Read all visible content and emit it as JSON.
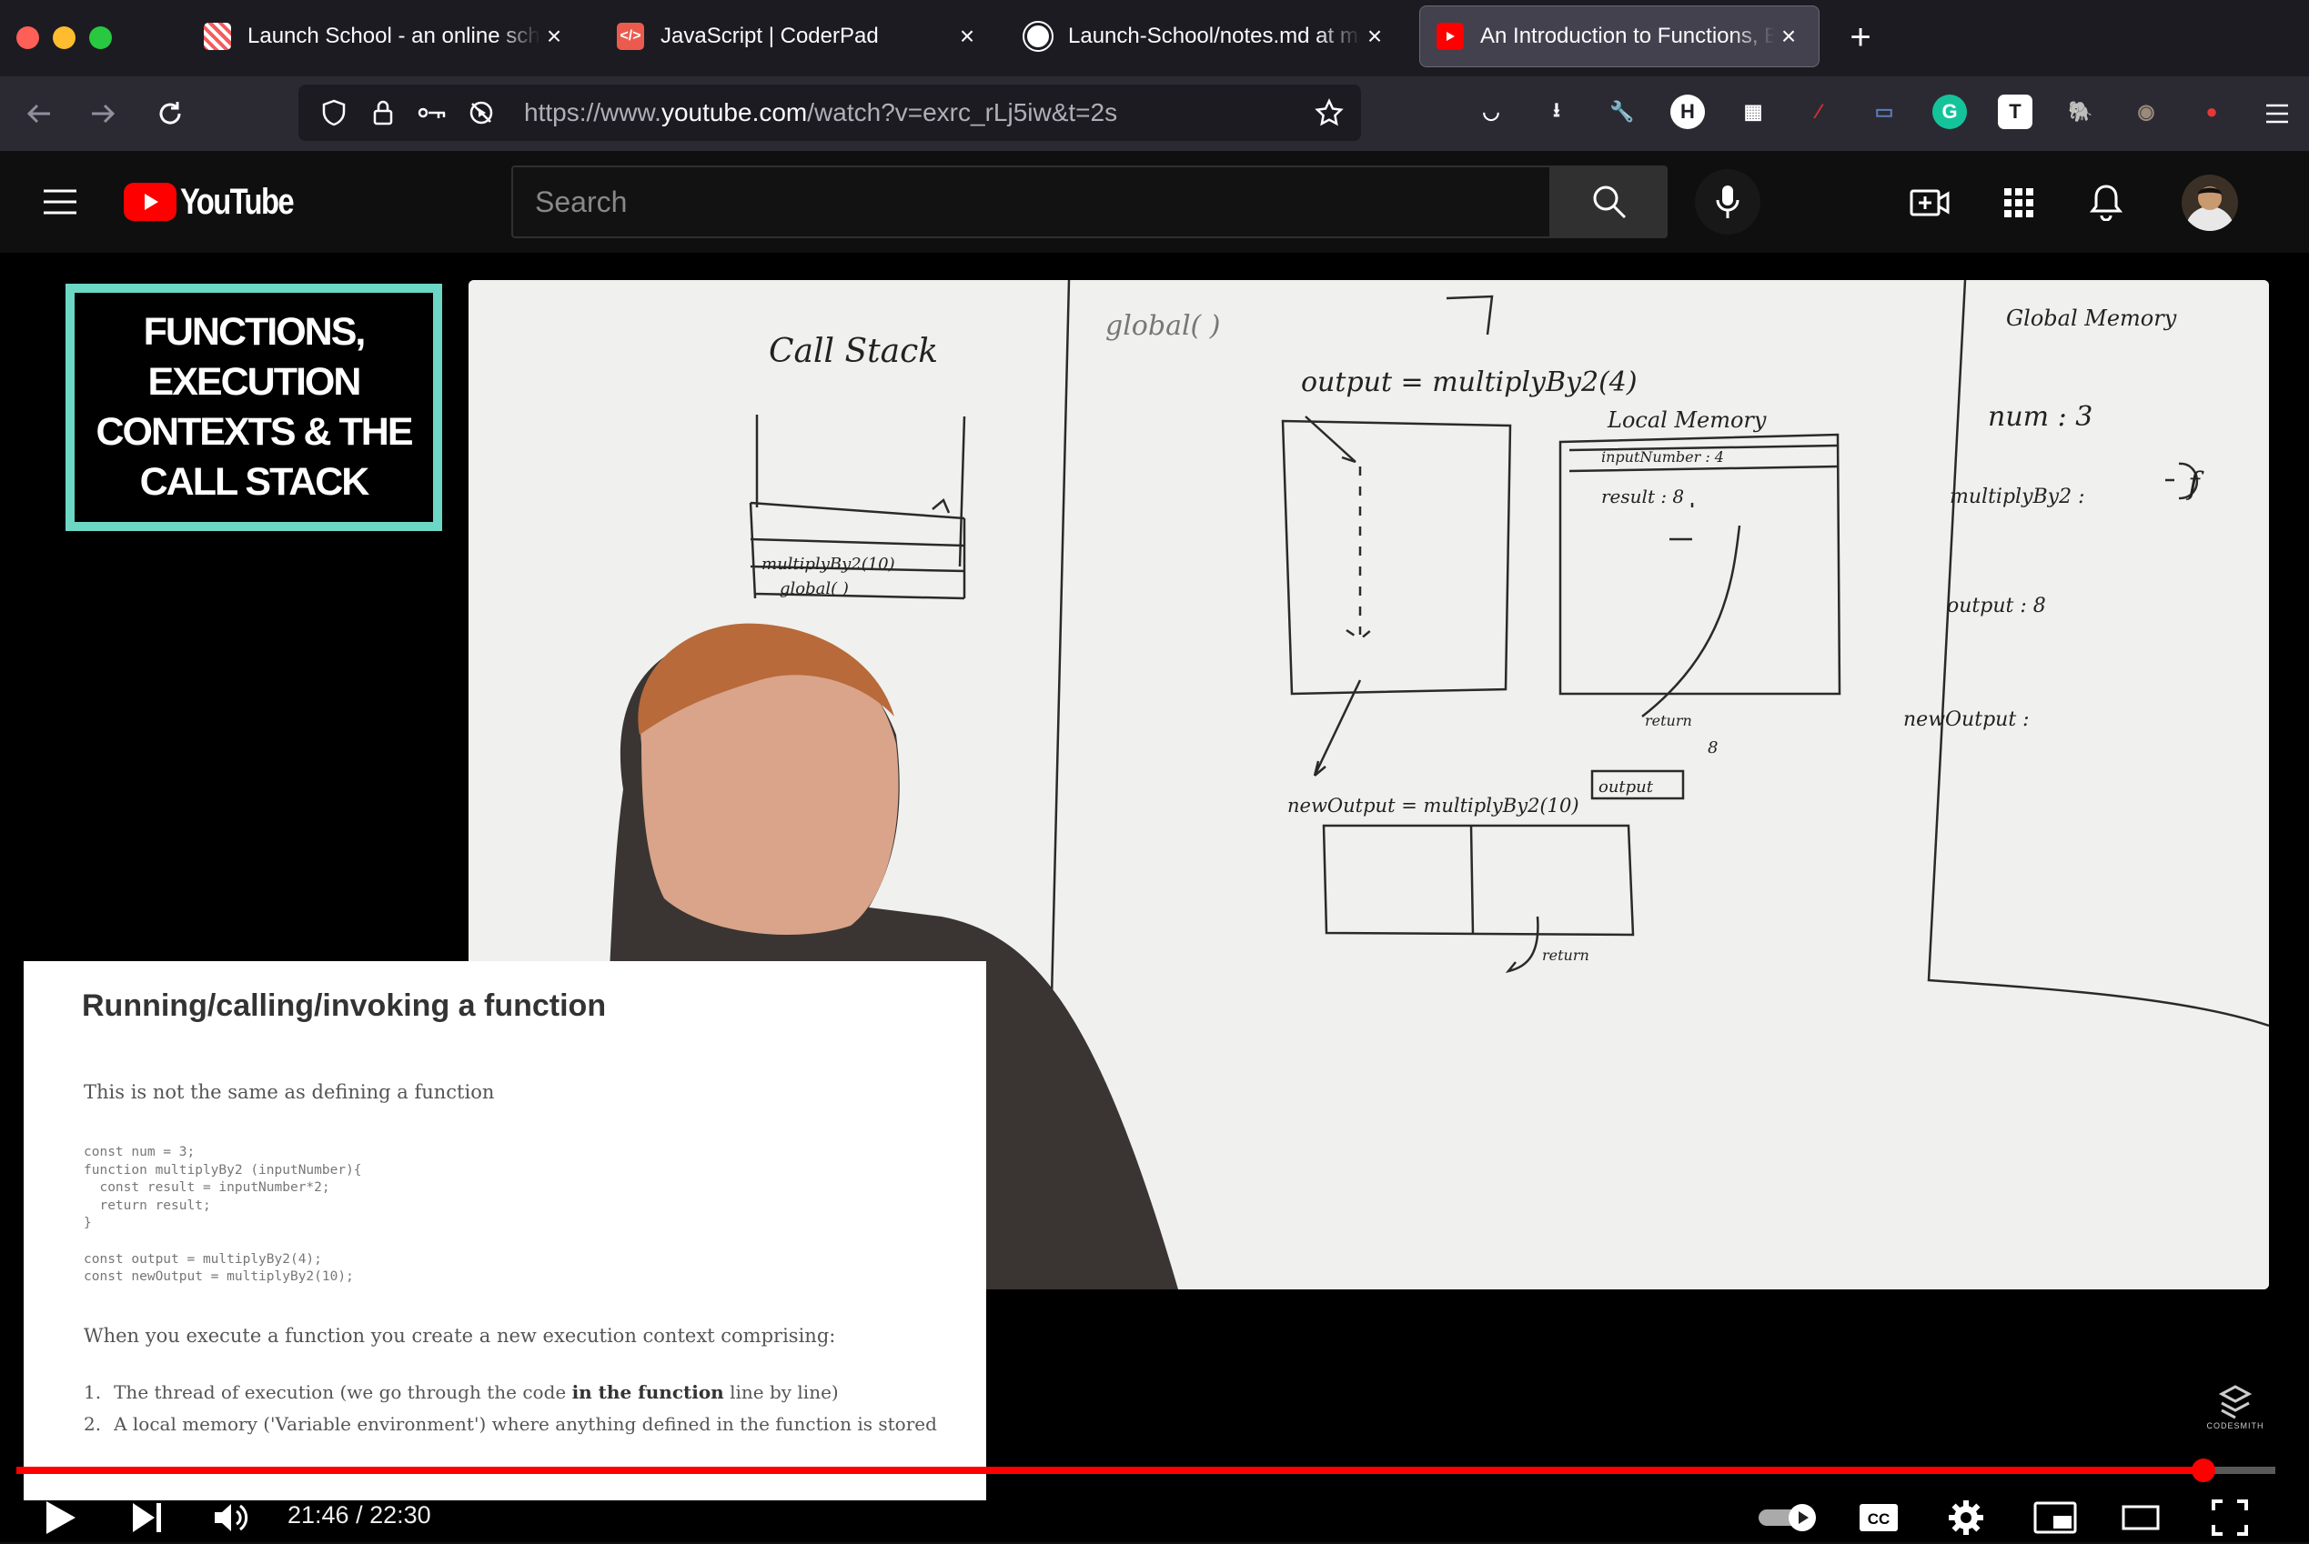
{
  "browser": {
    "tabs": [
      {
        "title": "Launch School - an online school",
        "favicon": "launch-school-favicon",
        "color": "#f45b5b"
      },
      {
        "title": "JavaScript | CoderPad",
        "favicon": "coderpad-favicon",
        "color": "#ea5b4e",
        "glyph": "</>"
      },
      {
        "title": "Launch-School/notes.md at main",
        "favicon": "github-favicon",
        "color": "#ffffff"
      },
      {
        "title": "An Introduction to Functions, Execution Contexts",
        "favicon": "youtube-favicon",
        "color": "#ff0000",
        "active": true
      }
    ],
    "close_glyph": "×",
    "new_tab_glyph": "+",
    "url_prefix": "https://www.",
    "url_domain": "youtube.com",
    "url_path": "/watch?v=exrc_rLj5iw&t=2s",
    "extensions": [
      {
        "name": "pocket-icon",
        "glyph": "◡"
      },
      {
        "name": "download-icon",
        "glyph": "⭳"
      },
      {
        "name": "wrench-icon",
        "glyph": "🔧"
      },
      {
        "name": "h-extension-icon",
        "glyph": "H",
        "color": "#ffffff"
      },
      {
        "name": "reader-extension-icon",
        "glyph": "▦"
      },
      {
        "name": "wand-extension-icon",
        "glyph": "⁄",
        "color": "#d62d2d"
      },
      {
        "name": "screenshot-extension-icon",
        "glyph": "▭",
        "color": "#5b7bb8"
      },
      {
        "name": "grammarly-icon",
        "glyph": "G",
        "color": "#15c39a"
      },
      {
        "name": "t-extension-icon",
        "glyph": "T",
        "color": "#ffffff"
      },
      {
        "name": "evernote-icon",
        "glyph": "🐘",
        "color": "#2dbe60"
      },
      {
        "name": "owl-extension-icon",
        "glyph": "◉",
        "color": "#9a8a7a"
      },
      {
        "name": "tomato-extension-icon",
        "glyph": "●",
        "color": "#e53935"
      }
    ]
  },
  "youtube": {
    "logo_text": "YouTube",
    "search_placeholder": "Search",
    "brand_color": "#ff0000"
  },
  "video": {
    "title_card": "FUNCTIONS,\nEXECUTION\nCONTEXTS & THE\nCALL STACK",
    "title_card_border_color": "#6cd7c5",
    "watermark": "CODESMITH",
    "time_current": "21:46",
    "time_separator": " / ",
    "time_total": "22:30",
    "progress": 0.968
  },
  "whiteboard": {
    "call_stack_title": "Call Stack",
    "stack_items": [
      "multiplyBy2(10)",
      "global( )"
    ],
    "global_call": "global( )",
    "output_line": "output = multiplyBy2(4)",
    "local_memory_title": "Local Memory",
    "local_input": "inputNumber : 4",
    "local_result": "result : 8",
    "return_label": "return",
    "return_value": "8",
    "output_box": "output",
    "new_output_line": "newOutput = multiplyBy2(10)",
    "global_memory_title": "Global Memory",
    "global_num": "num : 3",
    "global_fn": "multiplyBy2 :",
    "global_fn_value": "f",
    "global_output": "output : 8",
    "global_new_output": "newOutput :"
  },
  "slide": {
    "title": "Running/calling/invoking a function",
    "subtitle": "This is not the same as defining a function",
    "code": [
      "const num = 3;",
      "function multiplyBy2 (inputNumber){",
      "  const result = inputNumber*2;",
      "  return result;",
      "}",
      "",
      "const output = multiplyBy2(4);",
      "const newOutput = multiplyBy2(10);"
    ],
    "exec_text": "When you execute a function you create a new execution context comprising:",
    "items": [
      {
        "num": "1.",
        "before": "The thread of execution (we go through the code ",
        "bold": "in the function",
        "after": " line by line)"
      },
      {
        "num": "2.",
        "before": "A local memory ('Variable environment') where anything defined in the function is stored",
        "bold": "",
        "after": ""
      }
    ]
  }
}
